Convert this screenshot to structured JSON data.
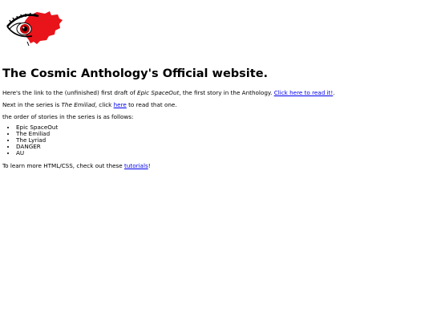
{
  "logo": {
    "icon": "red-eye-logo"
  },
  "heading": "The Cosmic Anthology's Official website.",
  "intro": {
    "before": "Here's the link to the (unfinished) first draft of ",
    "title": "Epic SpaceOut",
    "middle": ", the first story in the Anthology. ",
    "link": "Click here to read it!",
    "after": "."
  },
  "next": {
    "before": "Next in the series is ",
    "title": "The Emiliad",
    "middle": ", click ",
    "link": "here",
    "after": " to read that one."
  },
  "order_intro": "the order of stories in the series is as follows:",
  "stories": [
    "Epic SpaceOut",
    "The Emiliad",
    "The Lyriad",
    "DANGER",
    "AU"
  ],
  "learn": {
    "before": "To learn more HTML/CSS, check out these ",
    "link": "tutorials",
    "after": "!"
  },
  "colors": {
    "link": "#0000ee",
    "logo_red": "#e8141a"
  }
}
